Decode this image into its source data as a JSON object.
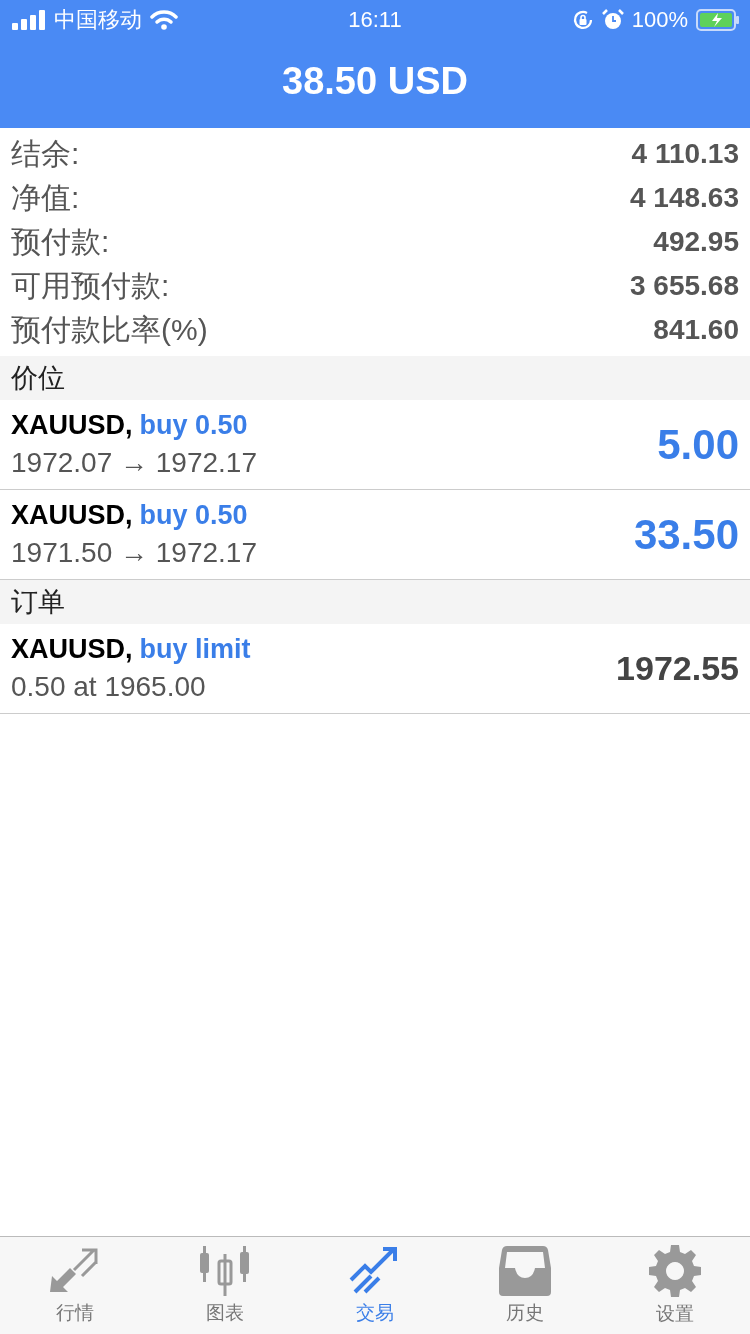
{
  "status_bar": {
    "carrier": "中国移动",
    "time": "16:11",
    "battery": "100%"
  },
  "header": {
    "title": "38.50 USD"
  },
  "summary": [
    {
      "label": "结余:",
      "value": "4 110.13"
    },
    {
      "label": "净值:",
      "value": "4 148.63"
    },
    {
      "label": "预付款:",
      "value": "492.95"
    },
    {
      "label": "可用预付款:",
      "value": "3 655.68"
    },
    {
      "label": "预付款比率(%)",
      "value": "841.60"
    }
  ],
  "sections": [
    {
      "title": "价位",
      "items": [
        {
          "kind": "position",
          "symbol": "XAUUSD,",
          "side": "buy 0.50",
          "detail": "1972.07 → 1972.17",
          "amount": "5.00"
        },
        {
          "kind": "position",
          "symbol": "XAUUSD,",
          "side": "buy 0.50",
          "detail": "1971.50 → 1972.17",
          "amount": "33.50"
        }
      ]
    },
    {
      "title": "订单",
      "items": [
        {
          "kind": "order",
          "symbol": "XAUUSD,",
          "side": "buy limit",
          "detail": "0.50 at 1965.00",
          "amount": "1972.55"
        }
      ]
    }
  ],
  "tab_bar": [
    {
      "label": "行情",
      "kind": "quotes",
      "selected": false
    },
    {
      "label": "图表",
      "kind": "chart",
      "selected": false
    },
    {
      "label": "交易",
      "kind": "trade",
      "selected": true
    },
    {
      "label": "历史",
      "kind": "history",
      "selected": false
    },
    {
      "label": "设置",
      "kind": "settings",
      "selected": false
    }
  ]
}
